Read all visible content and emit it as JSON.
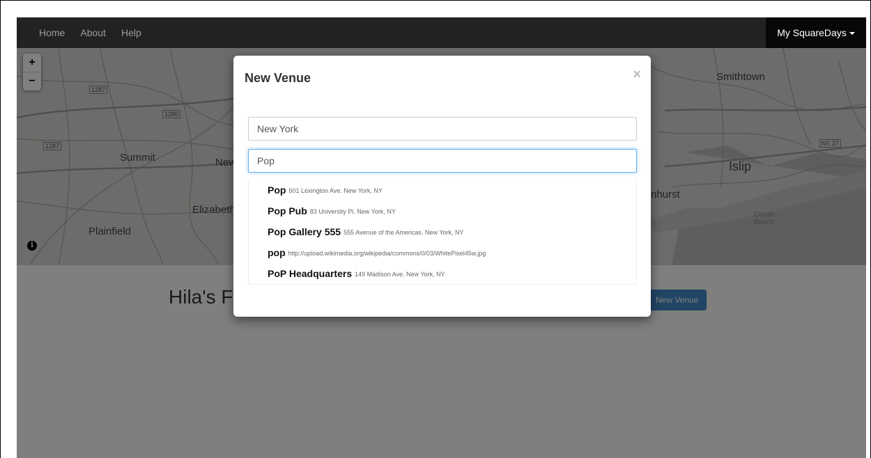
{
  "navbar": {
    "links": [
      "Home",
      "About",
      "Help"
    ],
    "user_menu": "My SquareDays"
  },
  "map": {
    "labels": {
      "summit": "Summit",
      "elizabeth": "Elizabeth",
      "plainfield": "Plainfield",
      "newark_partial": "New",
      "smithtown": "Smithtown",
      "islip": "Islip",
      "hurst_partial": "nhurst",
      "ocean_beach": "Ocean Beach",
      "route_287a": "1287",
      "route_287b": "1287",
      "route_280": "1280",
      "route_ny27": "NY 27"
    },
    "zoom_in": "+",
    "zoom_out": "−",
    "info": "i"
  },
  "content": {
    "title": "Hila's First SquareDay",
    "new_venue_button": "New Venue"
  },
  "modal": {
    "title": "New Venue",
    "close": "×",
    "city_value": "New York",
    "venue_value": "Pop",
    "suggestions": [
      {
        "name": "Pop",
        "address": "601 Lexington Ave. New York, NY"
      },
      {
        "name": "Pop Pub",
        "address": "83 University Pl. New York, NY"
      },
      {
        "name": "Pop Gallery 555",
        "address": "555 Avenue of the Americas. New York, NY"
      },
      {
        "name": "pop",
        "address": "http://upload.wikimedia.org/wikipedia/commons/0/03/WhitePixel45w.jpg"
      },
      {
        "name": "PoP Headquarters",
        "address": "149 Madison Ave. New York, NY"
      }
    ]
  },
  "colors": {
    "navbar": "#222222",
    "primary": "#428bca",
    "focus": "#66afe9"
  }
}
